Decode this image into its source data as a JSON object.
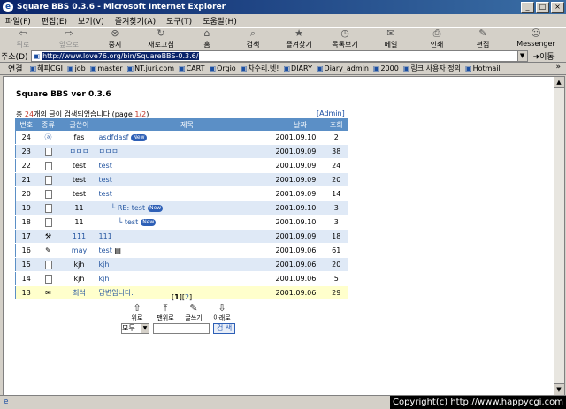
{
  "window": {
    "title": "Square BBS 0.3.6 - Microsoft Internet Explorer"
  },
  "menu": [
    "파일(F)",
    "편집(E)",
    "보기(V)",
    "즐겨찾기(A)",
    "도구(T)",
    "도움말(H)"
  ],
  "toolbar": {
    "back": "뒤로",
    "forward": "앞으로",
    "stop": "중지",
    "refresh": "새로고침",
    "home": "홈",
    "search": "검색",
    "favorites": "즐겨찾기",
    "history": "목록보기",
    "mail": "메일",
    "print": "인쇄",
    "edit": "편집",
    "messenger": "Messenger"
  },
  "address": {
    "label": "주소(D)",
    "url": "http://www.love76.org/bin/SquareBBS-0.3.6/",
    "go": "이동"
  },
  "links": {
    "label": "연결",
    "items": [
      "해피CGI",
      "job",
      "master",
      "NT.juri.com",
      "CART",
      "Orgio",
      "차수리.넷!",
      "DIARY",
      "Diary_admin",
      "2000",
      "링크 사용자 정의",
      "Hotmail"
    ],
    "more": "»"
  },
  "bbs": {
    "title": "Square BBS ver 0.3.6",
    "summary_pre": "총 ",
    "summary_count": "24",
    "summary_mid": "개의 글이 검색되었습니다.(page ",
    "summary_page": "1/2",
    "summary_end": ")",
    "admin": "[Admin]",
    "headers": {
      "num": "번호",
      "type": "종류",
      "author": "글쓴이",
      "subject": "제목",
      "date": "날짜",
      "views": "조회"
    },
    "rows": [
      {
        "num": "24",
        "type": "ⓐ",
        "author": "fas",
        "subject": "asdfdasf",
        "new": "New",
        "date": "2001.09.10",
        "views": "2"
      },
      {
        "num": "23",
        "type": "doc",
        "author": "ㅁㅁㅁ",
        "subject": "ㅁㅁㅁ",
        "date": "2001.09.09",
        "views": "38"
      },
      {
        "num": "22",
        "type": "doc",
        "author": "test",
        "subject": "test",
        "date": "2001.09.09",
        "views": "24"
      },
      {
        "num": "21",
        "type": "doc",
        "author": "test",
        "subject": "test",
        "date": "2001.09.09",
        "views": "20"
      },
      {
        "num": "20",
        "type": "doc",
        "author": "test",
        "subject": "test",
        "date": "2001.09.09",
        "views": "14"
      },
      {
        "num": "19",
        "type": "doc",
        "author": "11",
        "subject": "└ RE: test",
        "new": "New",
        "date": "2001.09.10",
        "views": "3"
      },
      {
        "num": "18",
        "type": "doc",
        "author": "11",
        "subject": "└ test",
        "new": "New",
        "date": "2001.09.10",
        "views": "3"
      },
      {
        "num": "17",
        "type": "⚒",
        "author": "111",
        "subject": "111",
        "date": "2001.09.09",
        "views": "18"
      },
      {
        "num": "16",
        "type": "✎",
        "author": "may",
        "subject": "test",
        "date": "2001.09.06",
        "views": "61"
      },
      {
        "num": "15",
        "type": "doc",
        "author": "kjh",
        "subject": "kjh",
        "date": "2001.09.06",
        "views": "20"
      },
      {
        "num": "14",
        "type": "doc",
        "author": "kjh",
        "subject": "kjh",
        "date": "2001.09.06",
        "views": "5"
      },
      {
        "num": "13",
        "type": "✉",
        "author": "최석",
        "subject": "답변입니다.",
        "date": "2001.09.06",
        "views": "29"
      }
    ],
    "pagination": {
      "open": "[",
      "current": "1",
      "sep": "][",
      "next": "2",
      "close": "]"
    },
    "nav": {
      "up": "위로",
      "top": "맨위로",
      "write": "글쓰기",
      "down": "아래로"
    },
    "search_select": "모두",
    "search_button": "검 색"
  },
  "status": {
    "copyright": "Copyright(c) http://www.happycgi.com"
  }
}
